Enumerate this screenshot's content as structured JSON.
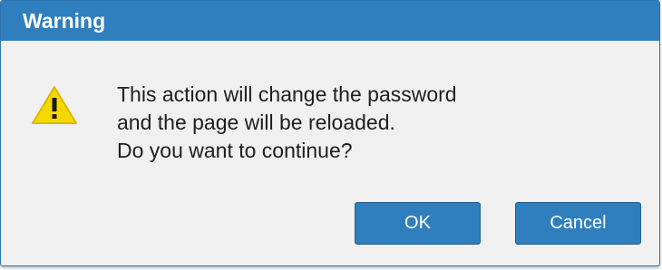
{
  "dialog": {
    "title": "Warning",
    "icon": "warning-triangle-icon",
    "message_lines": [
      "This action will change the password",
      "and the page will be reloaded.",
      "Do you want to continue?"
    ],
    "buttons": {
      "ok_label": "OK",
      "cancel_label": "Cancel"
    }
  },
  "colors": {
    "titlebar": "#2f7fbf",
    "button": "#2f7fbf",
    "warning_yellow": "#f5d800",
    "body_background": "#f0f0f0"
  }
}
